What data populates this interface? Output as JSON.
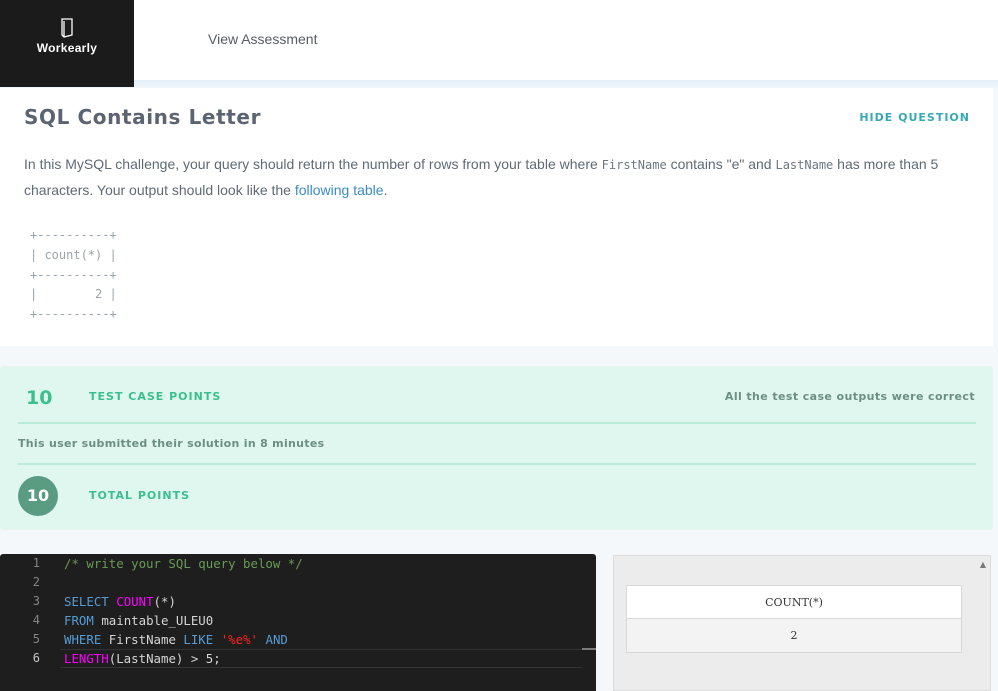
{
  "header": {
    "logo_text": "Workearly",
    "nav_link": "View Assessment"
  },
  "question": {
    "title": "SQL Contains Letter",
    "hide_label": "HIDE QUESTION",
    "text_1": "In this MySQL challenge, your query should return the number of rows from your table where ",
    "code_1": "FirstName",
    "text_2": " contains \"e\" and ",
    "code_2": "LastName",
    "text_3": " has more than 5 characters. Your output should look like the ",
    "link": "following table",
    "text_4": ".",
    "ascii_table": [
      "+----------+",
      "| count(*) |",
      "+----------+",
      "|        2 |",
      "+----------+"
    ]
  },
  "results": {
    "test_points": "10",
    "test_label": "TEST CASE POINTS",
    "test_status": "All the test case outputs were correct",
    "submitted_note": "This user submitted their solution in 8 minutes",
    "total_points": "10",
    "total_label": "TOTAL POINTS"
  },
  "editor": {
    "line_numbers": [
      "1",
      "2",
      "3",
      "4",
      "5",
      "6"
    ],
    "active_line": "6",
    "lines": [
      {
        "comment": "/* write your SQL query below */"
      },
      {},
      {
        "kw1": "SELECT",
        "fn": "COUNT",
        "rest": "(*)"
      },
      {
        "kw1": "FROM",
        "rest": "maintable_ULEU0"
      },
      {
        "kw1": "WHERE",
        "mid": "FirstName",
        "kw2": "LIKE",
        "str": "'%e%'",
        "kw3": "AND"
      },
      {
        "fn": "LENGTH",
        "rest": "(LastName) > 5;"
      }
    ]
  },
  "output": {
    "column_header": "COUNT(*)",
    "value": "2"
  },
  "colors": {
    "accent_teal": "#36a9b4",
    "success_green": "#3bbf8c",
    "results_bg": "#e0f7ef",
    "total_circle": "#5a9c82",
    "editor_bg": "#1e1e1e"
  }
}
